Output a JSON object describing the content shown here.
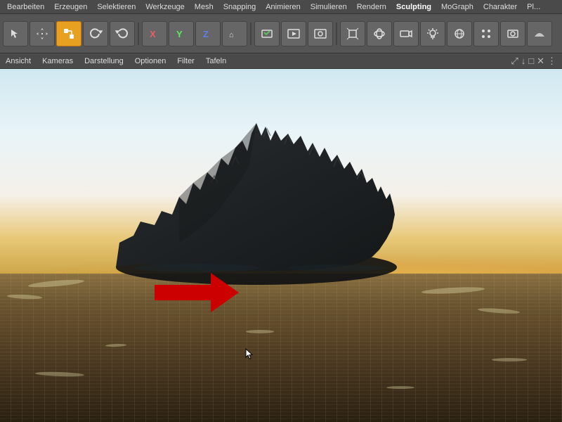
{
  "menubar": {
    "items": [
      "Bearbeiten",
      "Erzeugen",
      "Selektieren",
      "Werkzeuge",
      "Mesh",
      "Snapping",
      "Animieren",
      "Simulieren",
      "Rendern",
      "Sculpting",
      "MoGraph",
      "Charakter",
      "Pl..."
    ]
  },
  "toolbar": {
    "groups": [
      {
        "id": "select",
        "buttons": [
          "cursor",
          "move",
          "scale",
          "rotate-cw",
          "rotate-ccw"
        ]
      },
      {
        "id": "transform",
        "buttons": [
          "x-axis",
          "y-axis",
          "z-axis",
          "world"
        ]
      },
      {
        "id": "render",
        "buttons": [
          "render-region",
          "render-anim",
          "render-settings"
        ]
      },
      {
        "id": "view",
        "buttons": [
          "perspective",
          "orbit",
          "camera",
          "lights",
          "sky",
          "dots",
          "cam2",
          "light2"
        ]
      },
      {
        "id": "display",
        "buttons": [
          "display1",
          "display2"
        ]
      }
    ]
  },
  "viewport_menu": {
    "items": [
      "Ansicht",
      "Kameras",
      "Darstellung",
      "Optionen",
      "Filter",
      "Tafeln"
    ]
  },
  "viewport_icons": {
    "icons": [
      "arrows-expand",
      "arrow-down",
      "maximize",
      "close",
      "more"
    ]
  },
  "scene": {
    "description": "3D island mountain in ocean at sunset"
  }
}
